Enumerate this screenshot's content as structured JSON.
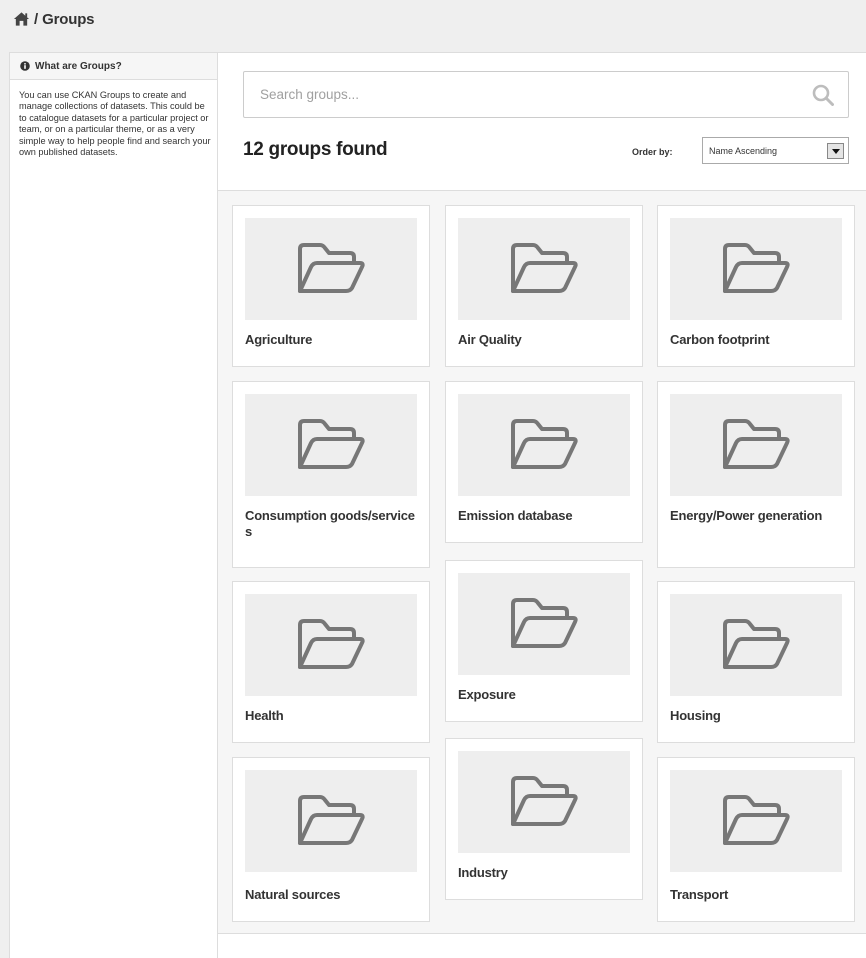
{
  "breadcrumb": {
    "home_icon": "home-icon",
    "separator": "/",
    "current": "Groups"
  },
  "sidebar": {
    "heading_icon": "info-icon",
    "heading": "What are Groups?",
    "body": "You can use CKAN Groups to create and manage collections of datasets. This could be to catalogue datasets for a particular project or team, or on a particular theme, or as a very simple way to help people find and search your own published datasets."
  },
  "search": {
    "placeholder": "Search groups...",
    "value": "",
    "icon": "search-icon"
  },
  "results": {
    "count_text": "12 groups found"
  },
  "order": {
    "label": "Order by:",
    "selected": "Name Ascending"
  },
  "groups": [
    {
      "title": "Agriculture",
      "icon": "folder-icon"
    },
    {
      "title": "Air Quality",
      "icon": "folder-icon"
    },
    {
      "title": "Carbon footprint",
      "icon": "folder-icon"
    },
    {
      "title": "Consumption goods/services",
      "icon": "folder-icon"
    },
    {
      "title": "Emission database",
      "icon": "folder-icon"
    },
    {
      "title": "Energy/Power generation",
      "icon": "folder-icon"
    },
    {
      "title": "Health",
      "icon": "folder-icon"
    },
    {
      "title": "Exposure",
      "icon": "folder-icon"
    },
    {
      "title": "Housing",
      "icon": "folder-icon"
    },
    {
      "title": "Natural sources",
      "icon": "folder-icon"
    },
    {
      "title": "Industry",
      "icon": "folder-icon"
    },
    {
      "title": "Transport",
      "icon": "folder-icon"
    }
  ],
  "colors": {
    "page_background": "#efefef",
    "panel_background": "#ffffff",
    "image_placeholder": "#eeeeee",
    "icon_stroke": "#777777",
    "text": "#333333"
  }
}
